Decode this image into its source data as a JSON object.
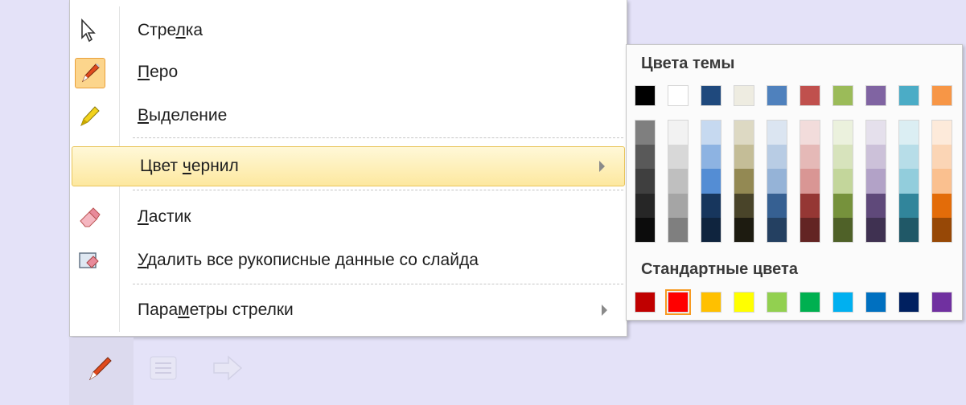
{
  "menu": {
    "items": [
      {
        "label_pre": "Стре",
        "label_u": "л",
        "label_post": "ка",
        "icon": "cursor-arrow-icon"
      },
      {
        "label_pre": "",
        "label_u": "П",
        "label_post": "еро",
        "icon": "pen-icon",
        "checked": true
      },
      {
        "label_pre": "",
        "label_u": "В",
        "label_post": "ыделение",
        "icon": "highlighter-icon"
      },
      {
        "label_pre": "Цвет ",
        "label_u": "ч",
        "label_post": "ернил",
        "submenu": true,
        "highlighted": true
      },
      {
        "label_pre": "",
        "label_u": "Л",
        "label_post": "астик",
        "icon": "eraser-icon"
      },
      {
        "label_pre": "",
        "label_u": "У",
        "label_post": "далить все рукописные данные со слайда",
        "icon": "erase-all-icon"
      },
      {
        "label_pre": "Пара",
        "label_u": "м",
        "label_post": "етры стрелки",
        "submenu": true
      }
    ]
  },
  "palette": {
    "theme_title": "Цвета темы",
    "standard_title": "Стандартные цвета",
    "theme_colors": [
      "#000000",
      "#ffffff",
      "#1f497d",
      "#eeece1",
      "#4f81bd",
      "#c0504d",
      "#9bbb59",
      "#8064a2",
      "#4bacc6",
      "#f79646"
    ],
    "theme_shades": [
      [
        "#7f7f7f",
        "#595959",
        "#3f3f3f",
        "#262626",
        "#0c0c0c"
      ],
      [
        "#f2f2f2",
        "#d8d8d8",
        "#bfbfbf",
        "#a5a5a5",
        "#7f7f7f"
      ],
      [
        "#c6d9f0",
        "#8db3e2",
        "#548dd4",
        "#17365d",
        "#0f243e"
      ],
      [
        "#ddd9c3",
        "#c4bd97",
        "#938953",
        "#494429",
        "#1d1b10"
      ],
      [
        "#dbe5f1",
        "#b8cce4",
        "#95b3d7",
        "#366092",
        "#244061"
      ],
      [
        "#f2dcdb",
        "#e5b9b7",
        "#d99694",
        "#953734",
        "#632423"
      ],
      [
        "#ebf1dd",
        "#d7e3bc",
        "#c3d69b",
        "#76923c",
        "#4f6128"
      ],
      [
        "#e5e0ec",
        "#ccc1d9",
        "#b2a2c7",
        "#5f497a",
        "#3f3151"
      ],
      [
        "#dbeef3",
        "#b7dde8",
        "#92cddc",
        "#31859b",
        "#205867"
      ],
      [
        "#fdeada",
        "#fbd5b5",
        "#fac08f",
        "#e36c09",
        "#974806"
      ]
    ],
    "standard_colors": [
      "#c00000",
      "#ff0000",
      "#ffc000",
      "#ffff00",
      "#92d050",
      "#00b050",
      "#00b0f0",
      "#0070c0",
      "#002060",
      "#7030a0"
    ],
    "selected_standard_index": 1
  },
  "bottom_toolbar": {
    "icons": [
      "pen-tool-icon",
      "menu-lines-icon",
      "next-arrow-icon"
    ]
  }
}
